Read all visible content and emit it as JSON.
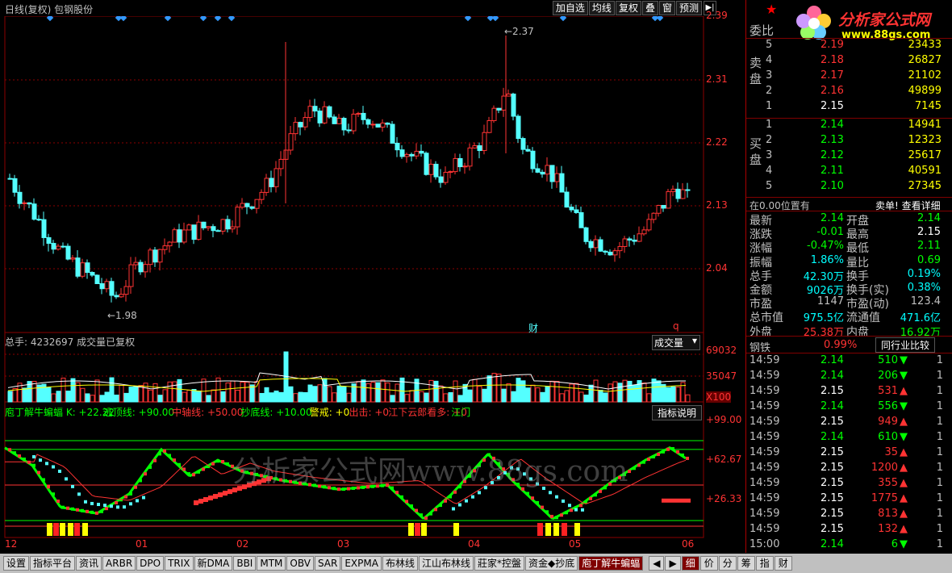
{
  "header": {
    "title": "日线(复权)   包钢股份",
    "tools": [
      "加自选",
      "均线",
      "复权",
      "叠",
      "窗",
      "预测"
    ]
  },
  "price_axis": [
    "2.39",
    "2.31",
    "2.22",
    "2.13",
    "2.04"
  ],
  "annotations": {
    "high": "2.37",
    "low": "1.98",
    "cai": "财",
    "q": "q"
  },
  "volume_panel": {
    "header": "总手: 4232697   成交量已复权",
    "selector": "成交量",
    "axis": [
      "69032",
      "35047",
      "X100"
    ]
  },
  "indicator_panel": {
    "segments": [
      {
        "t": "庖丁解牛蝙蝠 K: +22.22",
        "c": "#00ff00"
      },
      {
        "t": "逃顶线: +90.00",
        "c": "#00ff00"
      },
      {
        "t": "中轴线: +50.00",
        "c": "#ff3333"
      },
      {
        "t": "抄底线: +10.00",
        "c": "#00ff00"
      },
      {
        "t": "警戒: +0",
        "c": "#ffff00"
      },
      {
        "t": "出击: +0",
        "c": "#ff3333"
      },
      {
        "t": "江下云郎看多: +0",
        "c": "#ff3333"
      },
      {
        "t": "江门",
        "c": "#00ff00"
      }
    ],
    "button": "指标说明",
    "axis": [
      "+99.00",
      "+62.67",
      "+26.33"
    ]
  },
  "watermark": "分析家公式网www.88gs.com",
  "x_axis": [
    "12",
    "01",
    "02",
    "03",
    "04",
    "05",
    "06"
  ],
  "right_panel": {
    "logo_text": "分析家公式网",
    "logo_url": "www.88gs.com",
    "weibi": "委比",
    "sell_label": "卖盘",
    "buy_label": "买盘",
    "sell": [
      {
        "n": "5",
        "p": "2.19",
        "v": "23433"
      },
      {
        "n": "4",
        "p": "2.18",
        "v": "26827"
      },
      {
        "n": "3",
        "p": "2.17",
        "v": "21102"
      },
      {
        "n": "2",
        "p": "2.16",
        "v": "49899"
      },
      {
        "n": "1",
        "p": "2.15",
        "v": "7145"
      }
    ],
    "buy": [
      {
        "n": "1",
        "p": "2.14",
        "v": "14941"
      },
      {
        "n": "2",
        "p": "2.13",
        "v": "12323"
      },
      {
        "n": "3",
        "p": "2.12",
        "v": "25617"
      },
      {
        "n": "4",
        "p": "2.11",
        "v": "40591"
      },
      {
        "n": "5",
        "p": "2.10",
        "v": "27345"
      }
    ],
    "position_line": "在0.00位置有",
    "sell_detail": "卖单! 查看详细",
    "stats": [
      {
        "l": "最新",
        "v": "2.14",
        "vc": "#00ff00",
        "l2": "开盘",
        "v2": "2.14",
        "v2c": "#00ff00"
      },
      {
        "l": "涨跌",
        "v": "-0.01",
        "vc": "#00ff00",
        "l2": "最高",
        "v2": "2.15",
        "v2c": "#ffffff"
      },
      {
        "l": "涨幅",
        "v": "-0.47%",
        "vc": "#00ff00",
        "l2": "最低",
        "v2": "2.11",
        "v2c": "#00ff00"
      },
      {
        "l": "振幅",
        "v": "1.86%",
        "vc": "#00ffff",
        "l2": "量比",
        "v2": "0.69",
        "v2c": "#00ff00"
      },
      {
        "l": "总手",
        "v": "42.30万",
        "vc": "#00ffff",
        "l2": "换手",
        "v2": "0.19%",
        "v2c": "#00ffff"
      },
      {
        "l": "金额",
        "v": "9026万",
        "vc": "#00ffff",
        "l2": "换手(实)",
        "v2": "0.38%",
        "v2c": "#00ffff"
      },
      {
        "l": "市盈",
        "v": "1147",
        "vc": "#c0c0c0",
        "l2": "市盈(动)",
        "v2": "123.4",
        "v2c": "#c0c0c0"
      },
      {
        "l": "总市值",
        "v": "975.5亿",
        "vc": "#00ffff",
        "l2": "流通值",
        "v2": "471.6亿",
        "v2c": "#00ffff"
      },
      {
        "l": "外盘",
        "v": "25.38万",
        "vc": "#ff3333",
        "l2": "内盘",
        "v2": "16.92万",
        "v2c": "#00ff00"
      }
    ],
    "industry": "钢铁",
    "industry_pct": "0.99%",
    "compare_btn": "同行业比较",
    "ticks": [
      {
        "t": "14:59",
        "p": "2.14",
        "pc": "#00ff00",
        "v": "510",
        "d": "dn",
        "n": "1"
      },
      {
        "t": "14:59",
        "p": "2.14",
        "pc": "#00ff00",
        "v": "206",
        "d": "dn",
        "n": "1"
      },
      {
        "t": "14:59",
        "p": "2.15",
        "pc": "#ffffff",
        "v": "531",
        "d": "up",
        "n": "1"
      },
      {
        "t": "14:59",
        "p": "2.14",
        "pc": "#00ff00",
        "v": "556",
        "d": "dn",
        "n": "1"
      },
      {
        "t": "14:59",
        "p": "2.15",
        "pc": "#ffffff",
        "v": "949",
        "d": "up",
        "n": "1"
      },
      {
        "t": "14:59",
        "p": "2.14",
        "pc": "#00ff00",
        "v": "610",
        "d": "dn",
        "n": "1"
      },
      {
        "t": "14:59",
        "p": "2.15",
        "pc": "#ffffff",
        "v": "35",
        "d": "up",
        "n": "1"
      },
      {
        "t": "14:59",
        "p": "2.15",
        "pc": "#ffffff",
        "v": "1200",
        "d": "up",
        "n": "1"
      },
      {
        "t": "14:59",
        "p": "2.15",
        "pc": "#ffffff",
        "v": "355",
        "d": "up",
        "n": "1"
      },
      {
        "t": "14:59",
        "p": "2.15",
        "pc": "#ffffff",
        "v": "1775",
        "d": "up",
        "n": "1"
      },
      {
        "t": "14:59",
        "p": "2.15",
        "pc": "#ffffff",
        "v": "813",
        "d": "up",
        "n": "1"
      },
      {
        "t": "14:59",
        "p": "2.15",
        "pc": "#ffffff",
        "v": "132",
        "d": "up",
        "n": "1"
      },
      {
        "t": "15:00",
        "p": "2.14",
        "pc": "#00ff00",
        "v": "6",
        "d": "dn",
        "n": "1"
      }
    ]
  },
  "bottom_tabs": [
    "设置",
    "指标平台",
    "资讯",
    "ARBR",
    "DPO",
    "TRIX",
    "新DMA",
    "BBI",
    "MTM",
    "OBV",
    "SAR",
    "EXPMA",
    "布林线",
    "江山布林线",
    "莊家*控盤",
    "资金◆抄底",
    "庖丁解牛蝙蝠"
  ],
  "right_tabs": [
    "细",
    "价",
    "分",
    "筹",
    "指",
    "财"
  ],
  "colors": {
    "up": "#ff3333",
    "down": "#54ffff",
    "grid": "#8b0000"
  }
}
